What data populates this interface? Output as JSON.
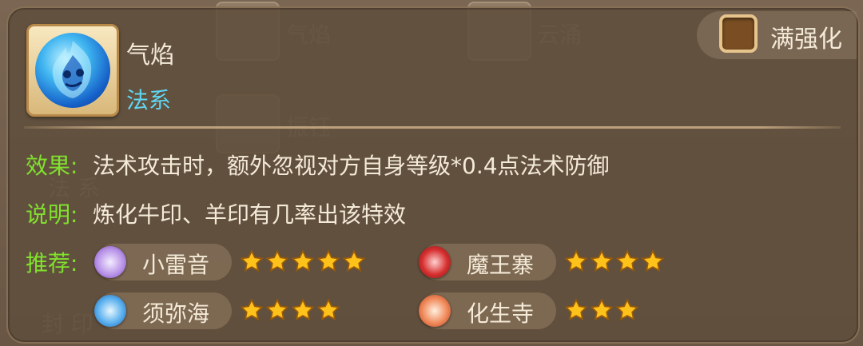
{
  "skill": {
    "name": "气焰",
    "type": "法系",
    "icon": "blue-flame-spirit-icon"
  },
  "full_enhance_label": "满强化",
  "effect": {
    "label": "效果:",
    "text": "法术攻击时，额外忽视对方自身等级*0.4点法术防御"
  },
  "description": {
    "label": "说明:",
    "text": "炼化牛印、羊印有几率出该特效"
  },
  "recommend": {
    "label": "推荐:",
    "sects": [
      {
        "name": "小雷音",
        "stars": 5,
        "icon": "xiaoleiyin-emblem-icon",
        "color": "#8a5cc8"
      },
      {
        "name": "魔王寨",
        "stars": 4,
        "icon": "mowangzhai-emblem-icon",
        "color": "#c82020"
      },
      {
        "name": "须弥海",
        "stars": 4,
        "icon": "xumihai-emblem-icon",
        "color": "#2a8ad8"
      },
      {
        "name": "化生寺",
        "stars": 3,
        "icon": "huashengsi-emblem-icon",
        "color": "#e05a3a"
      }
    ]
  },
  "background_items": [
    "气焰",
    "云涌",
    "振钰",
    "法 系",
    "封 印"
  ],
  "colors": {
    "label_green": "#80e12e",
    "type_cyan": "#5fd6f2",
    "star_gold": "#ffc21a"
  }
}
